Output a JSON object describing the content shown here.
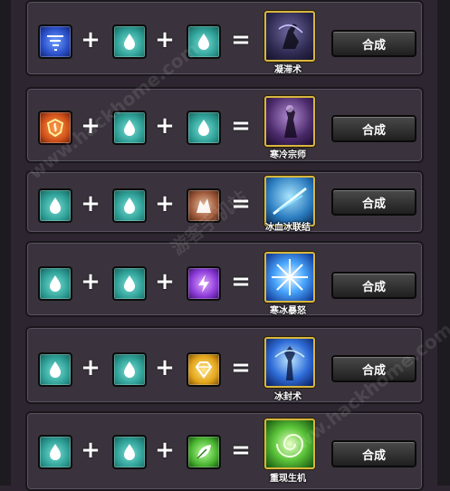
{
  "recipes": [
    {
      "ingredients": [
        {
          "icon": "tornado-icon",
          "color": "blue"
        },
        {
          "icon": "water-drop-icon",
          "color": "teal"
        },
        {
          "icon": "water-drop-icon",
          "color": "teal"
        }
      ],
      "plus": "+",
      "equals": "=",
      "result": {
        "name": "凝滞术",
        "icon": "archer-silhouette-icon"
      },
      "button": "合成"
    },
    {
      "ingredients": [
        {
          "icon": "fire-shield-icon",
          "color": "orange"
        },
        {
          "icon": "water-drop-icon",
          "color": "teal"
        },
        {
          "icon": "water-drop-icon",
          "color": "teal"
        }
      ],
      "plus": "+",
      "equals": "=",
      "result": {
        "name": "寒冷宗师",
        "icon": "mage-silhouette-icon"
      },
      "button": "合成"
    },
    {
      "ingredients": [
        {
          "icon": "water-drop-icon",
          "color": "teal"
        },
        {
          "icon": "water-drop-icon",
          "color": "teal"
        },
        {
          "icon": "rock-icon",
          "color": "brownish"
        }
      ],
      "plus": "+",
      "equals": "=",
      "result": {
        "name": "冰血冰联结",
        "icon": "ice-strike-icon"
      },
      "button": "合成"
    },
    {
      "ingredients": [
        {
          "icon": "water-drop-icon",
          "color": "teal"
        },
        {
          "icon": "water-drop-icon",
          "color": "teal"
        },
        {
          "icon": "lightning-icon",
          "color": "purple"
        }
      ],
      "plus": "+",
      "equals": "=",
      "result": {
        "name": "寒冰暴怒",
        "icon": "ice-burst-icon"
      },
      "button": "合成"
    },
    {
      "ingredients": [
        {
          "icon": "water-drop-icon",
          "color": "teal"
        },
        {
          "icon": "water-drop-icon",
          "color": "teal"
        },
        {
          "icon": "gem-icon",
          "color": "gold"
        }
      ],
      "plus": "+",
      "equals": "=",
      "result": {
        "name": "冰封术",
        "icon": "frozen-figure-icon"
      },
      "button": "合成"
    },
    {
      "ingredients": [
        {
          "icon": "water-drop-icon",
          "color": "teal"
        },
        {
          "icon": "water-drop-icon",
          "color": "teal"
        },
        {
          "icon": "leaf-icon",
          "color": "green"
        }
      ],
      "plus": "+",
      "equals": "=",
      "result": {
        "name": "重现生机",
        "icon": "nature-swirl-icon"
      },
      "button": "合成"
    }
  ],
  "watermarks": [
    "www.hackhome.com",
    "游客手机站",
    "www.hackhome.com"
  ]
}
